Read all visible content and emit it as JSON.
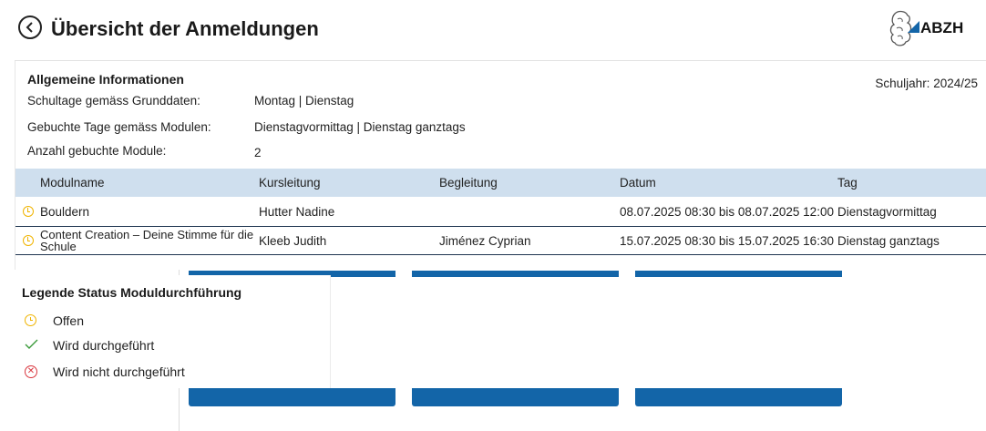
{
  "header": {
    "title": "Übersicht der Anmeldungen",
    "logo_text": "ABZH",
    "logo_color": "#1365a8"
  },
  "info": {
    "title": "Allgemeine Informationen",
    "schuljahr": "Schuljahr: 2024/25",
    "rows": [
      {
        "label": "Schultage gemäss Grunddaten:",
        "value": "Montag | Dienstag"
      },
      {
        "label": "Gebuchte Tage gemäss Modulen:",
        "value": "Dienstagvormittag | Dienstag ganztags"
      },
      {
        "label": "Anzahl gebuchte Module:",
        "value": "2"
      }
    ]
  },
  "table": {
    "header_bg": "#cfdfee",
    "columns": [
      "Modulname",
      "Kursleitung",
      "Begleitung",
      "Datum",
      "Tag"
    ],
    "rows": [
      {
        "status_icon": "clock-icon",
        "status": "Offen",
        "modulname": "Bouldern",
        "kursleitung": "Hutter Nadine",
        "begleitung": "",
        "datum": "08.07.2025 08:30 bis 08.07.2025 12:00",
        "tag": "Dienstagvormittag"
      },
      {
        "status_icon": "clock-icon",
        "status": "Offen",
        "modulname": "Content Creation – Deine Stimme für die Schule",
        "kursleitung": "Kleeb Judith",
        "begleitung": "Jiménez Cyprian",
        "datum": "15.07.2025 08:30 bis 15.07.2025 16:30",
        "tag": "Dienstag ganztags"
      }
    ]
  },
  "legend": {
    "title": "Legende Status Moduldurchführung",
    "items": [
      {
        "icon": "clock-icon",
        "label": "Offen",
        "color": "#f0b400"
      },
      {
        "icon": "check-icon",
        "label": "Wird durchgeführt",
        "color": "#3a9a3a"
      },
      {
        "icon": "x-circle-icon",
        "label": "Wird nicht durchgeführt",
        "color": "#d9363e"
      }
    ]
  }
}
